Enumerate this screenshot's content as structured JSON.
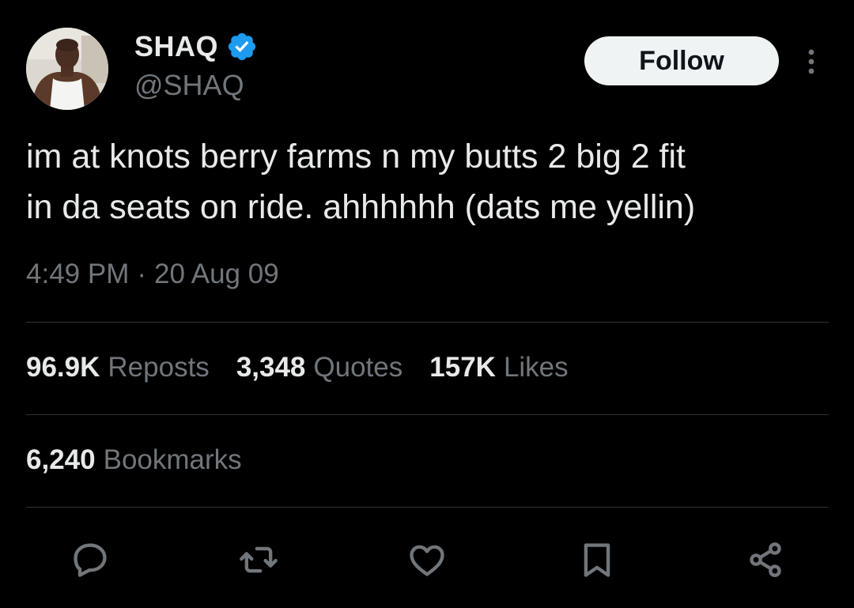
{
  "author": {
    "name": "SHAQ",
    "handle": "@SHAQ",
    "verified": true
  },
  "follow_label": "Follow",
  "tweet": {
    "text_line1": "im at knots berry farms n my butts 2 big 2 fit",
    "text_line2": "in da seats on ride. ahhhhhh (dats me yellin)",
    "time": "4:49 PM",
    "separator": "·",
    "date": "20 Aug 09"
  },
  "stats": {
    "reposts": {
      "value": "96.9K",
      "label": "Reposts"
    },
    "quotes": {
      "value": "3,348",
      "label": "Quotes"
    },
    "likes": {
      "value": "157K",
      "label": "Likes"
    },
    "bookmarks": {
      "value": "6,240",
      "label": "Bookmarks"
    }
  },
  "actions": [
    "reply-icon",
    "repost-icon",
    "like-icon",
    "bookmark-icon",
    "share-icon"
  ],
  "colors": {
    "background": "#000000",
    "text": "#e7e9ea",
    "secondary": "#71767b",
    "divider": "#2f3336",
    "verified": "#1d9bf0",
    "follow_bg": "#eff3f4"
  }
}
